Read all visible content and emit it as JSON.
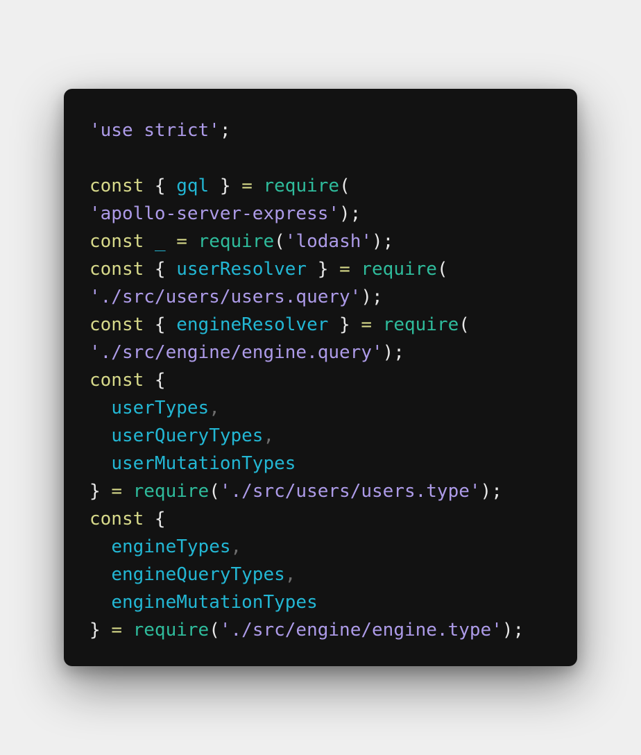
{
  "theme": {
    "background": "#efefef",
    "window_background": "#121212",
    "keyword_color": "#d7d98a",
    "string_color": "#ad9be8",
    "function_color": "#2fbc9c",
    "identifier_color": "#23b7d4",
    "punctuation_color": "#e8e8e8",
    "comma_color": "#6e6e6e"
  },
  "code_lines": [
    [
      {
        "t": "str",
        "v": "'use strict'"
      },
      {
        "t": "pn",
        "v": ";"
      }
    ],
    [],
    [
      {
        "t": "kw",
        "v": "const"
      },
      {
        "t": "pn",
        "v": " { "
      },
      {
        "t": "id",
        "v": "gql"
      },
      {
        "t": "pn",
        "v": " } "
      },
      {
        "t": "kw",
        "v": "="
      },
      {
        "t": "pn",
        "v": " "
      },
      {
        "t": "fn",
        "v": "require"
      },
      {
        "t": "pn",
        "v": "("
      }
    ],
    [
      {
        "t": "str",
        "v": "'apollo-server-express'"
      },
      {
        "t": "pn",
        "v": ");"
      }
    ],
    [
      {
        "t": "kw",
        "v": "const"
      },
      {
        "t": "pn",
        "v": " "
      },
      {
        "t": "id",
        "v": "_"
      },
      {
        "t": "pn",
        "v": " "
      },
      {
        "t": "kw",
        "v": "="
      },
      {
        "t": "pn",
        "v": " "
      },
      {
        "t": "fn",
        "v": "require"
      },
      {
        "t": "pn",
        "v": "("
      },
      {
        "t": "str",
        "v": "'lodash'"
      },
      {
        "t": "pn",
        "v": ");"
      }
    ],
    [
      {
        "t": "kw",
        "v": "const"
      },
      {
        "t": "pn",
        "v": " { "
      },
      {
        "t": "id",
        "v": "userResolver"
      },
      {
        "t": "pn",
        "v": " } "
      },
      {
        "t": "kw",
        "v": "="
      },
      {
        "t": "pn",
        "v": " "
      },
      {
        "t": "fn",
        "v": "require"
      },
      {
        "t": "pn",
        "v": "("
      }
    ],
    [
      {
        "t": "str",
        "v": "'./src/users/users.query'"
      },
      {
        "t": "pn",
        "v": ");"
      }
    ],
    [
      {
        "t": "kw",
        "v": "const"
      },
      {
        "t": "pn",
        "v": " { "
      },
      {
        "t": "id",
        "v": "engineResolver"
      },
      {
        "t": "pn",
        "v": " } "
      },
      {
        "t": "kw",
        "v": "="
      },
      {
        "t": "pn",
        "v": " "
      },
      {
        "t": "fn",
        "v": "require"
      },
      {
        "t": "pn",
        "v": "("
      }
    ],
    [
      {
        "t": "str",
        "v": "'./src/engine/engine.query'"
      },
      {
        "t": "pn",
        "v": ");"
      }
    ],
    [
      {
        "t": "kw",
        "v": "const"
      },
      {
        "t": "pn",
        "v": " {"
      }
    ],
    [
      {
        "t": "pn",
        "v": "  "
      },
      {
        "t": "id",
        "v": "userTypes"
      },
      {
        "t": "cm",
        "v": ","
      }
    ],
    [
      {
        "t": "pn",
        "v": "  "
      },
      {
        "t": "id",
        "v": "userQueryTypes"
      },
      {
        "t": "cm",
        "v": ","
      }
    ],
    [
      {
        "t": "pn",
        "v": "  "
      },
      {
        "t": "id",
        "v": "userMutationTypes"
      }
    ],
    [
      {
        "t": "pn",
        "v": "} "
      },
      {
        "t": "kw",
        "v": "="
      },
      {
        "t": "pn",
        "v": " "
      },
      {
        "t": "fn",
        "v": "require"
      },
      {
        "t": "pn",
        "v": "("
      },
      {
        "t": "str",
        "v": "'./src/users/users.type'"
      },
      {
        "t": "pn",
        "v": ");"
      }
    ],
    [
      {
        "t": "kw",
        "v": "const"
      },
      {
        "t": "pn",
        "v": " {"
      }
    ],
    [
      {
        "t": "pn",
        "v": "  "
      },
      {
        "t": "id",
        "v": "engineTypes"
      },
      {
        "t": "cm",
        "v": ","
      }
    ],
    [
      {
        "t": "pn",
        "v": "  "
      },
      {
        "t": "id",
        "v": "engineQueryTypes"
      },
      {
        "t": "cm",
        "v": ","
      }
    ],
    [
      {
        "t": "pn",
        "v": "  "
      },
      {
        "t": "id",
        "v": "engineMutationTypes"
      }
    ],
    [
      {
        "t": "pn",
        "v": "} "
      },
      {
        "t": "kw",
        "v": "="
      },
      {
        "t": "pn",
        "v": " "
      },
      {
        "t": "fn",
        "v": "require"
      },
      {
        "t": "pn",
        "v": "("
      },
      {
        "t": "str",
        "v": "'./src/engine/engine.type'"
      },
      {
        "t": "pn",
        "v": ");"
      }
    ]
  ]
}
